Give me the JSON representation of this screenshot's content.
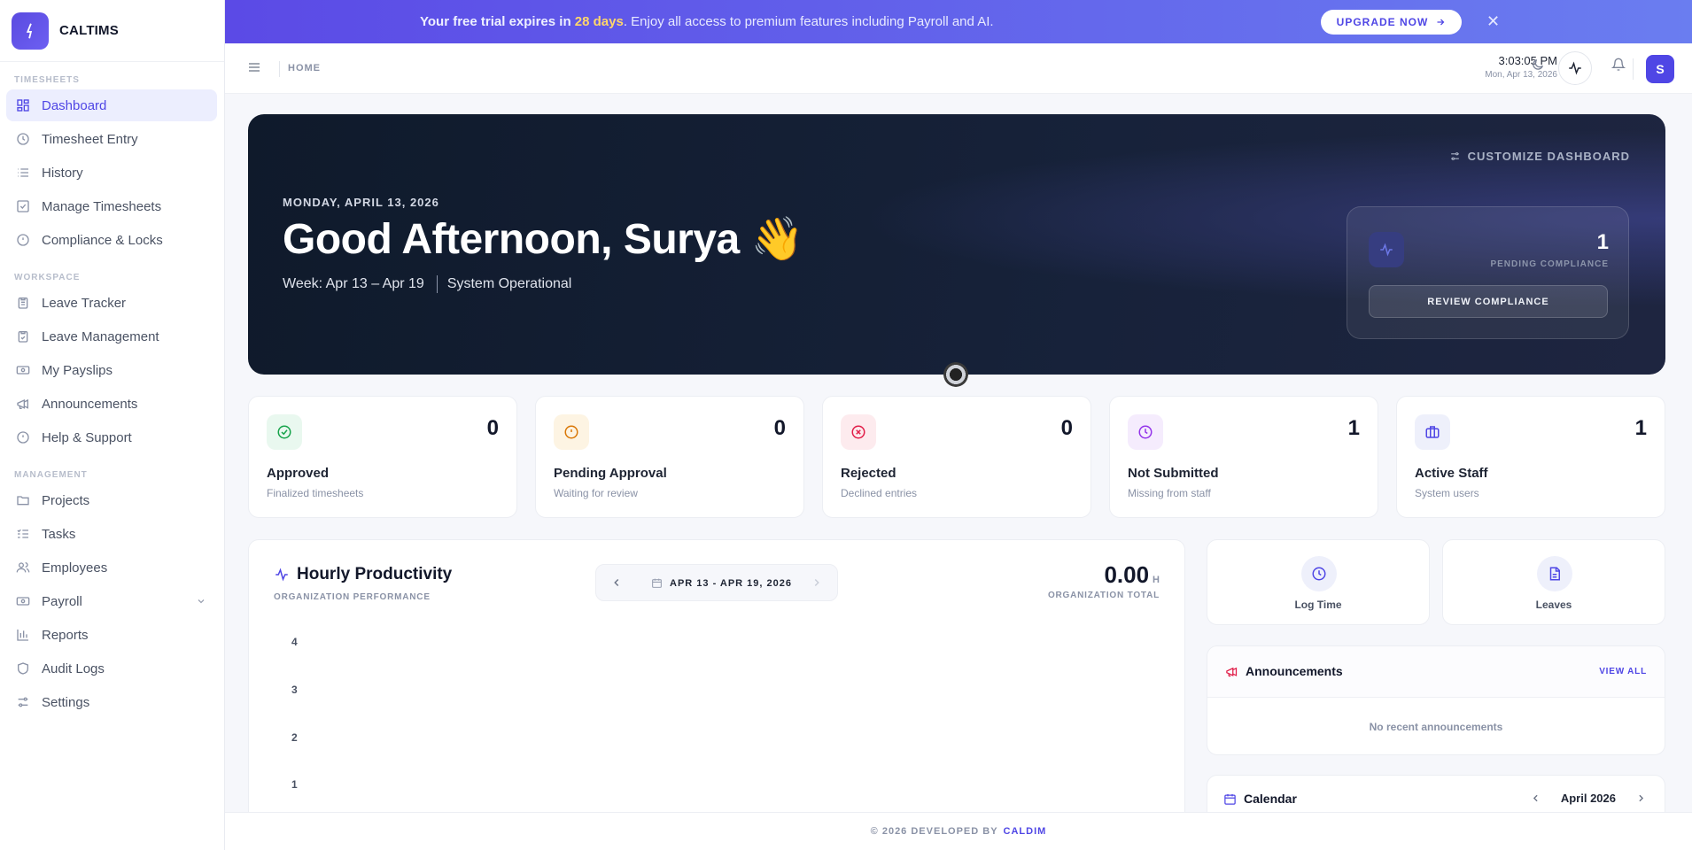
{
  "app": {
    "name": "CALTIMS"
  },
  "sidebar": {
    "sections": [
      {
        "label": "TIMESHEETS"
      },
      {
        "label": "WORKSPACE"
      },
      {
        "label": "MANAGEMENT"
      }
    ],
    "items": [
      {
        "label": "Dashboard",
        "icon": "dashboard-icon",
        "active": true
      },
      {
        "label": "Timesheet Entry",
        "icon": "clock-icon"
      },
      {
        "label": "History",
        "icon": "list-icon"
      },
      {
        "label": "Manage Timesheets",
        "icon": "checkbox-icon"
      },
      {
        "label": "Compliance & Locks",
        "icon": "alert-circle-icon"
      },
      {
        "label": "Leave Tracker",
        "icon": "clipboard-icon"
      },
      {
        "label": "Leave Management",
        "icon": "clipboard-check-icon"
      },
      {
        "label": "My Payslips",
        "icon": "banknote-icon"
      },
      {
        "label": "Announcements",
        "icon": "megaphone-icon"
      },
      {
        "label": "Help & Support",
        "icon": "help-circle-icon"
      },
      {
        "label": "Projects",
        "icon": "folder-icon"
      },
      {
        "label": "Tasks",
        "icon": "task-list-icon"
      },
      {
        "label": "Employees",
        "icon": "users-icon"
      },
      {
        "label": "Payroll",
        "icon": "banknote-icon"
      },
      {
        "label": "Reports",
        "icon": "bar-chart-icon"
      },
      {
        "label": "Audit Logs",
        "icon": "shield-icon"
      },
      {
        "label": "Settings",
        "icon": "sliders-icon"
      }
    ]
  },
  "banner": {
    "prefix": "Your free trial expires in ",
    "days": "28 days",
    "rest": ". Enjoy all access to premium features including Payroll and AI.",
    "upgrade_label": "UPGRADE NOW",
    "close": "✕"
  },
  "topbar": {
    "breadcrumb": "HOME",
    "time": "3:03:05 PM",
    "date": "Mon, Apr 13, 2026",
    "avatar_initial": "S"
  },
  "hero": {
    "date": "MONDAY, APRIL 13, 2026",
    "greeting": "Good Afternoon, Surya",
    "emoji": "👋",
    "week": "Week: Apr 13 – Apr 19",
    "status": "System Operational",
    "customize_label": "CUSTOMIZE DASHBOARD",
    "compliance": {
      "count": "1",
      "label": "PENDING COMPLIANCE",
      "button": "REVIEW COMPLIANCE"
    }
  },
  "stats": [
    {
      "value": "0",
      "title": "Approved",
      "subtitle": "Finalized timesheets",
      "color": "#16a34a",
      "bg": "#e9f8ef"
    },
    {
      "value": "0",
      "title": "Pending Approval",
      "subtitle": "Waiting for review",
      "color": "#d97706",
      "bg": "#fdf4e3"
    },
    {
      "value": "0",
      "title": "Rejected",
      "subtitle": "Declined entries",
      "color": "#e11d48",
      "bg": "#fdebee"
    },
    {
      "value": "1",
      "title": "Not Submitted",
      "subtitle": "Missing from staff",
      "color": "#9333ea",
      "bg": "#f5ecfd"
    },
    {
      "value": "1",
      "title": "Active Staff",
      "subtitle": "System users",
      "color": "#4f46e5",
      "bg": "#eef0fb"
    }
  ],
  "productivity": {
    "title": "Hourly Productivity",
    "subtitle": "ORGANIZATION PERFORMANCE",
    "range": "APR 13 - APR 19, 2026",
    "total": "0.00",
    "total_unit": "H",
    "total_label": "ORGANIZATION TOTAL",
    "y_ticks": [
      "4",
      "3",
      "2",
      "1"
    ]
  },
  "quick_actions": [
    {
      "label": "Log Time",
      "icon": "clock-icon"
    },
    {
      "label": "Leaves",
      "icon": "file-icon"
    }
  ],
  "announcements": {
    "title": "Announcements",
    "view_all": "VIEW ALL",
    "empty": "No recent announcements"
  },
  "calendar": {
    "title": "Calendar",
    "month": "April 2026"
  },
  "footer": {
    "text": "© 2026 DEVELOPED BY",
    "brand": "CALDIM"
  },
  "colors": {
    "accent": "#4f46e5",
    "banner_start": "#5b4ae6",
    "hero_bg": "#0f1a2b"
  }
}
